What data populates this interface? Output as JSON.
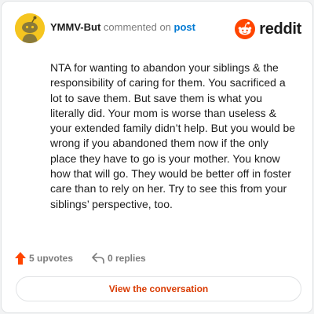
{
  "comment": {
    "username": "YMMV-But",
    "action": "commented on",
    "target": "post",
    "body": "NTA for wanting to abandon your siblings & the responsibility of caring for them. You sacrificed a lot to save them. But save them is what you literally did. Your mom is worse than useless & your extended family didn’t help. But you would be wrong if you abandoned them now if the only place they have to go is your mother. You know how that will go. They would be better off in foster care than to rely on her. Try to see this from your siblings’ perspective, too."
  },
  "brand": {
    "wordmark": "reddit",
    "icon": "reddit-snoo-icon",
    "color": "#ff4500"
  },
  "stats": {
    "upvotes": "5 upvotes",
    "upvote_icon": "upvote-arrow-icon",
    "replies": "0 replies",
    "reply_icon": "reply-arrow-icon"
  },
  "cta": {
    "label": "View the conversation"
  },
  "colors": {
    "accent": "#d93a00",
    "link": "#0079d3",
    "avatar_bg": "#f5c51f",
    "muted": "#7c7c7c"
  }
}
